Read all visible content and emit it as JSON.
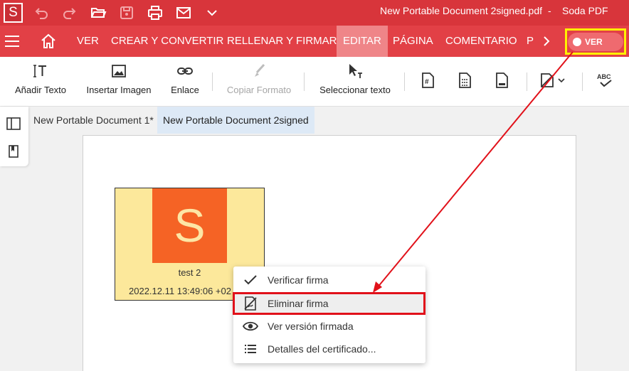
{
  "app": {
    "logo_letter": "S",
    "document_title": "New Portable Document 2signed.pdf",
    "separator": "-",
    "app_name": "Soda PDF"
  },
  "quick_access": [
    {
      "icon": "undo-icon"
    },
    {
      "icon": "redo-icon"
    },
    {
      "icon": "open-folder-icon"
    },
    {
      "icon": "save-icon"
    },
    {
      "icon": "print-icon"
    },
    {
      "icon": "mail-icon"
    },
    {
      "icon": "chevron-down-icon"
    }
  ],
  "menu": {
    "tabs": [
      "VER",
      "CREAR Y CONVERTIR",
      "RELLENAR Y FIRMAR",
      "EDITAR",
      "PÁGINA",
      "COMENTARIO",
      "P"
    ],
    "active_tab": "EDITAR",
    "ver_toggle_label": "VER"
  },
  "toolbar": {
    "tools": [
      {
        "label": "Añadir Texto",
        "icon": "add-text-icon"
      },
      {
        "label": "Insertar Imagen",
        "icon": "image-icon"
      },
      {
        "label": "Enlace",
        "icon": "link-icon"
      },
      {
        "label": "Copiar Formato",
        "icon": "format-painter-icon",
        "disabled": true
      },
      {
        "label": "Seleccionar texto",
        "icon": "select-text-cursor-icon"
      }
    ]
  },
  "doc_tabs": [
    "New Portable Document 1*",
    "New Portable Document 2signed"
  ],
  "signature": {
    "logo_letter": "S",
    "name": "test 2",
    "date": "2022.12.11 13:49:06 +02"
  },
  "context_menu": {
    "items": [
      {
        "label": "Verificar firma",
        "icon": "checkmark-icon"
      },
      {
        "label": "Eliminar firma",
        "icon": "remove-signature-icon"
      },
      {
        "label": "Ver versión firmada",
        "icon": "eye-icon"
      },
      {
        "label": "Detalles del certificado...",
        "icon": "list-icon"
      }
    ],
    "highlighted_item": "Eliminar firma"
  },
  "colors": {
    "titlebar": "#d8353b",
    "menubar": "#e24046",
    "active_tab": "#ef8588",
    "highlight_frame_yellow": "#fff200",
    "highlight_frame_red": "#e1111a",
    "signature_bg": "#fce89b",
    "signature_logo": "#f56325"
  }
}
